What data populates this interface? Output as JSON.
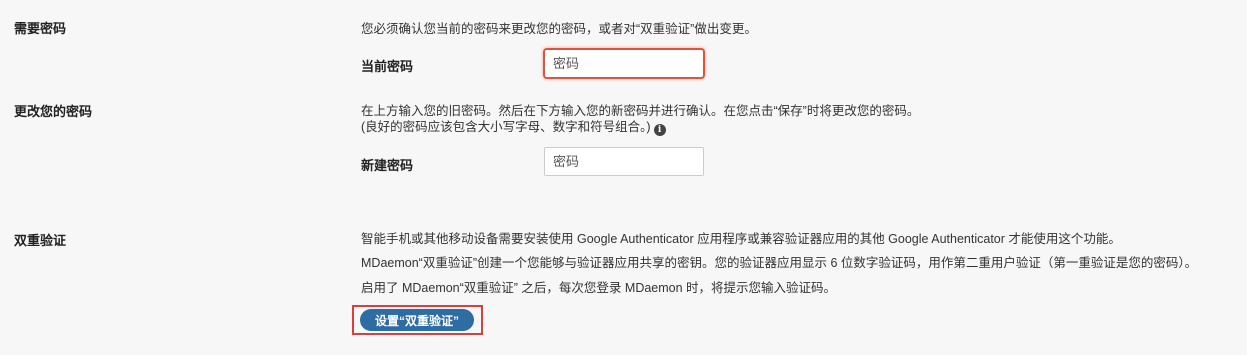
{
  "require_password": {
    "label": "需要密码",
    "description": "您必须确认您当前的密码来更改您的密码，或者对“双重验证”做出变更。",
    "current_password_label": "当前密码",
    "current_password_placeholder": "密码"
  },
  "change_password": {
    "label": "更改您的密码",
    "description_line1": "在上方输入您的旧密码。然后在下方输入您的新密码并进行确认。在您点击“保存”时将更改您的密码。",
    "description_line2": "(良好的密码应该包含大小写字母、数字和符号组合。)",
    "info_icon_glyph": "i",
    "new_password_label": "新建密码",
    "new_password_placeholder": "密码"
  },
  "two_factor": {
    "label": "双重验证",
    "description_line1": "智能手机或其他移动设备需要安装使用 Google Authenticator 应用程序或兼容验证器应用的其他 Google Authenticator 才能使用这个功能。",
    "description_line2": "MDaemon“双重验证”创建一个您能够与验证器应用共享的密钥。您的验证器应用显示 6 位数字验证码，用作第二重用户验证（第一重验证是您的密码）。",
    "description_line3": "启用了 MDaemon“双重验证” 之后，每次您登录 MDaemon 时，将提示您输入验证码。",
    "setup_button_label": "设置“双重验证”"
  },
  "colors": {
    "accent_button": "#2e6da4",
    "highlight_border": "#e0533c"
  }
}
